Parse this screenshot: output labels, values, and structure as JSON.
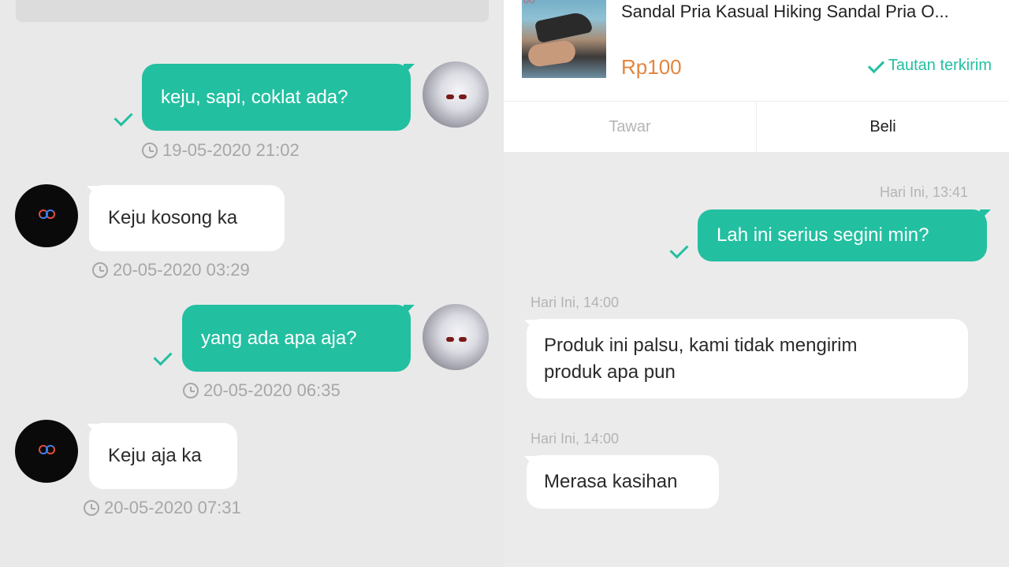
{
  "left": {
    "messages": [
      {
        "from": "user",
        "text": "keju, sapi, coklat ada?",
        "timestamp": "19-05-2020 21:02"
      },
      {
        "from": "shop",
        "text": "Keju kosong ka",
        "timestamp": "20-05-2020 03:29"
      },
      {
        "from": "user",
        "text": "yang ada apa aja?",
        "timestamp": "20-05-2020 06:35"
      },
      {
        "from": "shop",
        "text": "Keju aja ka",
        "timestamp": "20-05-2020 07:31"
      }
    ]
  },
  "right": {
    "product": {
      "title": "Sandal Pria Kasual Hiking Sandal Pria O...",
      "price": "Rp100",
      "link_status": "Tautan terkirim"
    },
    "actions": {
      "tawar": "Tawar",
      "beli": "Beli"
    },
    "messages": [
      {
        "from": "user",
        "time": "Hari Ini, 13:41",
        "text": "Lah ini serius segini min?"
      },
      {
        "from": "shop",
        "time": "Hari Ini, 14:00",
        "lines": [
          "Produk ini palsu, kami tidak mengirim",
          "produk apa pun"
        ]
      },
      {
        "from": "shop",
        "time": "Hari Ini, 14:00",
        "text": "Merasa kasihan"
      }
    ]
  },
  "colors": {
    "sent_bubble": "#23bfa1",
    "received_bubble": "#ffffff",
    "price": "#e4853e",
    "background": "#e9e9e9"
  },
  "icons": [
    "clock-icon",
    "check-icon",
    "user-avatar",
    "shop-avatar"
  ]
}
